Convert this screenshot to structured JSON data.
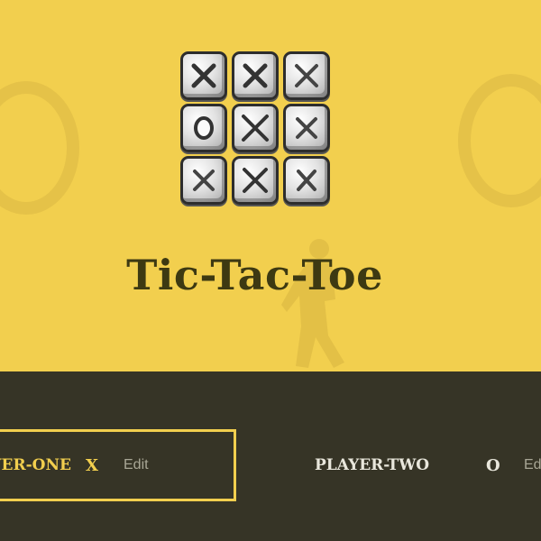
{
  "title": "Tic-Tac-Toe",
  "logo": {
    "tiles": [
      "x",
      "x",
      "x",
      "o",
      "x",
      "x",
      "x",
      "x",
      "x"
    ]
  },
  "players": [
    {
      "name": "PLAYER-ONE",
      "symbol": "X",
      "edit_label": "Edit",
      "active": true
    },
    {
      "name": "PLAYER-TWO",
      "symbol": "O",
      "edit_label": "Edit",
      "active": false
    }
  ],
  "colors": {
    "hero_background": "#f2cf4e",
    "panel_background": "#363426",
    "title": "#3d3912",
    "active_player": "#f2cf4e",
    "inactive_player": "#e9e7dc",
    "edit_link": "#a9a796"
  }
}
